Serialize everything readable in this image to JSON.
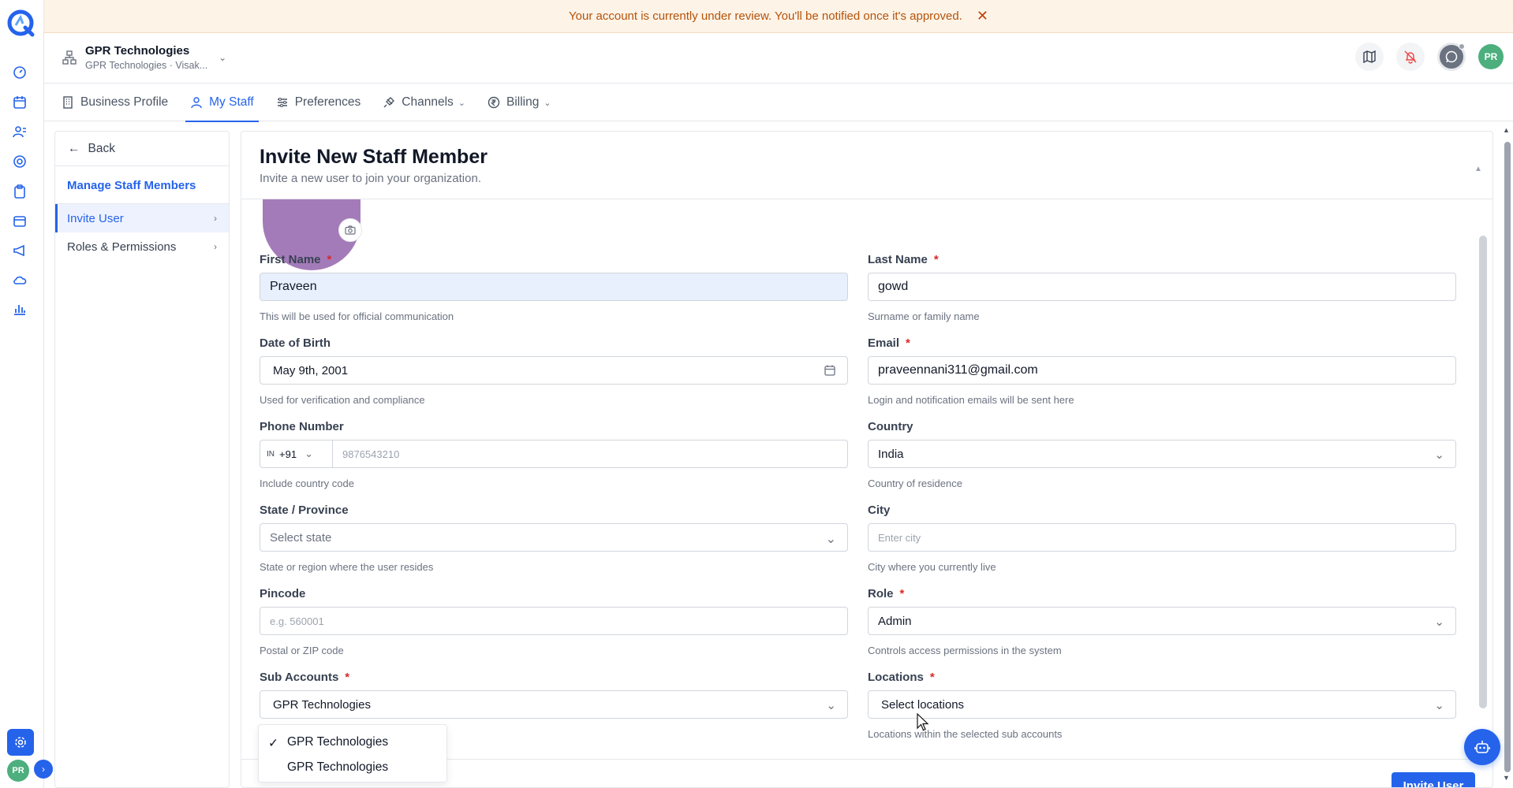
{
  "banner": {
    "message": "Your account is currently under review. You'll be notified once it's approved.",
    "close": "✕"
  },
  "header": {
    "org_name": "GPR Technologies",
    "org_sub": "GPR Technologies · Visak...",
    "avatar": "PR"
  },
  "tabs": [
    {
      "label": "Business Profile",
      "icon": "building-icon"
    },
    {
      "label": "My Staff",
      "icon": "user-icon",
      "active": true
    },
    {
      "label": "Preferences",
      "icon": "sliders-icon"
    },
    {
      "label": "Channels",
      "icon": "plug-icon"
    },
    {
      "label": "Billing",
      "icon": "rupee-icon"
    }
  ],
  "sidenav": {
    "back": "Back",
    "title": "Manage Staff Members",
    "items": [
      {
        "label": "Invite User",
        "active": true
      },
      {
        "label": "Roles & Permissions"
      }
    ]
  },
  "page": {
    "title": "Invite New Staff Member",
    "subtitle": "Invite a new user to join your organization."
  },
  "form": {
    "first_name": {
      "label": "First Name",
      "value": "Praveen",
      "help": "This will be used for official communication"
    },
    "last_name": {
      "label": "Last Name",
      "value": "gowd",
      "help": "Surname or family name"
    },
    "dob": {
      "label": "Date of Birth",
      "value": "May 9th, 2001",
      "help": "Used for verification and compliance"
    },
    "email": {
      "label": "Email",
      "value": "praveennani311@gmail.com",
      "help": "Login and notification emails will be sent here"
    },
    "phone": {
      "label": "Phone Number",
      "flag": "IN",
      "code": "+91",
      "placeholder": "9876543210",
      "help": "Include country code"
    },
    "country": {
      "label": "Country",
      "value": "India",
      "help": "Country of residence"
    },
    "state": {
      "label": "State / Province",
      "placeholder": "Select state",
      "help": "State or region where the user resides"
    },
    "city": {
      "label": "City",
      "placeholder": "Enter city",
      "help": "City where you currently live"
    },
    "pincode": {
      "label": "Pincode",
      "placeholder": "e.g. 560001",
      "help": "Postal or ZIP code"
    },
    "role": {
      "label": "Role",
      "value": "Admin",
      "help": "Controls access permissions in the system"
    },
    "sub_accounts": {
      "label": "Sub Accounts",
      "value": "GPR Technologies",
      "options": [
        "GPR Technologies",
        "GPR Technologies"
      ]
    },
    "locations": {
      "label": "Locations",
      "placeholder": "Select locations",
      "help": "Locations within the selected sub accounts"
    },
    "required_mark": "*"
  },
  "actions": {
    "invite": "Invite User"
  },
  "colors": {
    "accent": "#2563eb",
    "banner_bg": "#fdf3e7",
    "banner_text": "#b45309",
    "required": "#dc2626",
    "avatar_bg": "#4caf7d",
    "photo_bg": "#a47bb9"
  }
}
